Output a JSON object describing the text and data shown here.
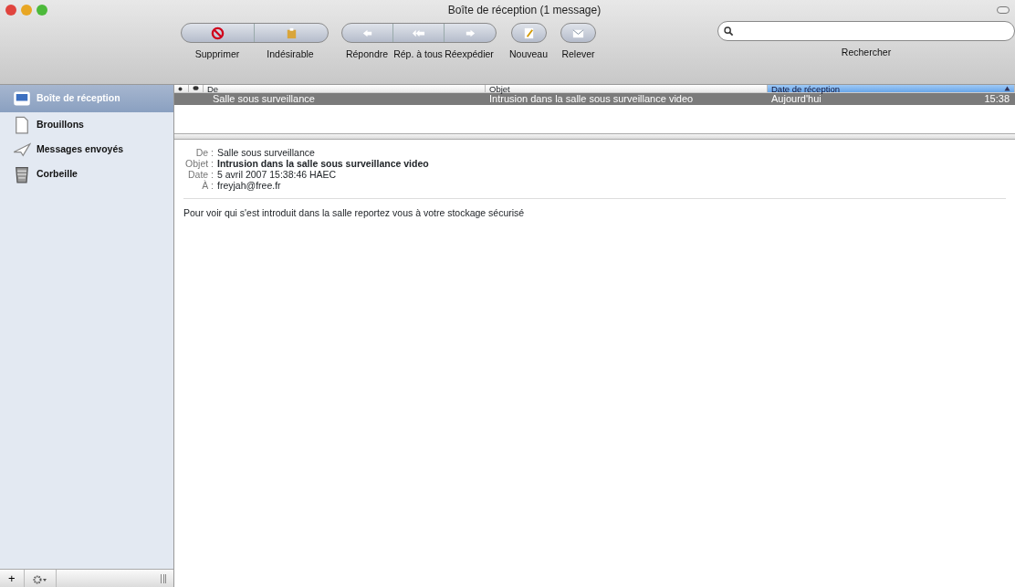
{
  "window": {
    "title": "Boîte de réception (1 message)"
  },
  "toolbar": {
    "groups": [
      {
        "buttons": [
          {
            "label": "Supprimer",
            "kind": "delete"
          },
          {
            "label": "Indésirable",
            "kind": "junk"
          }
        ]
      },
      {
        "buttons": [
          {
            "label": "Répondre",
            "kind": "reply"
          },
          {
            "label": "Rép. à tous",
            "kind": "replyall"
          },
          {
            "label": "Réexpédier",
            "kind": "forward"
          }
        ]
      },
      {
        "buttons": [
          {
            "label": "Nouveau",
            "kind": "new"
          }
        ]
      },
      {
        "buttons": [
          {
            "label": "Relever",
            "kind": "get"
          }
        ]
      }
    ],
    "search": {
      "label": "Rechercher"
    }
  },
  "sidebar": {
    "items": [
      {
        "label": "Boîte de réception",
        "kind": "inbox",
        "selected": true
      },
      {
        "label": "Brouillons",
        "kind": "drafts",
        "selected": false
      },
      {
        "label": "Messages envoyés",
        "kind": "sent",
        "selected": false
      },
      {
        "label": "Corbeille",
        "kind": "trash",
        "selected": false
      }
    ],
    "add_button": "+"
  },
  "message_list": {
    "columns": [
      {
        "label": "De",
        "sorted": false
      },
      {
        "label": "Objet",
        "sorted": false
      },
      {
        "label": "Date de réception",
        "sorted": true
      }
    ],
    "rows": [
      {
        "from": "Salle sous surveillance",
        "subject": "Intrusion dans la salle sous surveillance video",
        "date": "Aujourd'hui",
        "time": "15:38",
        "selected": true
      }
    ]
  },
  "preview": {
    "headers": [
      {
        "label": "De :",
        "value": "Salle sous surveillance",
        "bold": false
      },
      {
        "label": "Objet :",
        "value": "Intrusion dans la salle sous surveillance video",
        "bold": true
      },
      {
        "label": "Date :",
        "value": "5 avril 2007 15:38:46 HAEC",
        "bold": false
      },
      {
        "label": "À :",
        "value": "freyjah@free.fr",
        "bold": false
      }
    ],
    "body": "Pour voir qui s'est introduit dans la salle reportez vous à votre stockage sécurisé"
  }
}
